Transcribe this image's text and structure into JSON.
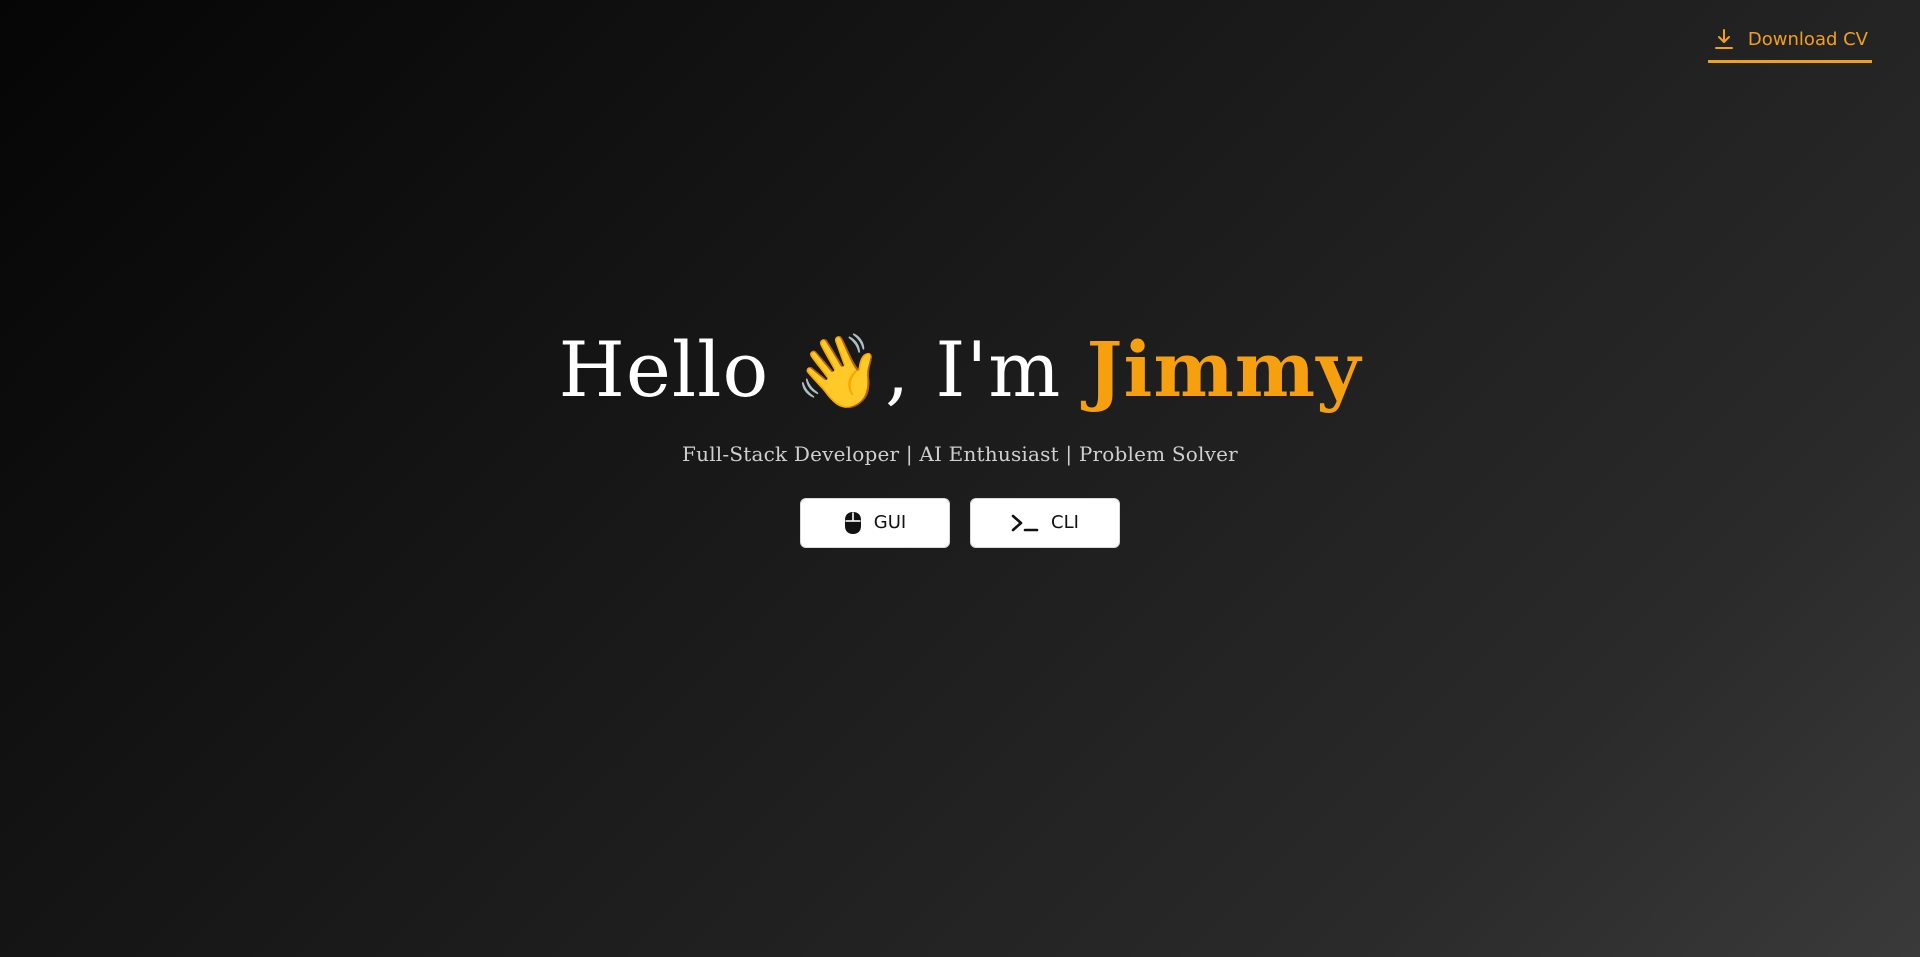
{
  "header": {
    "download_cv_label": "Download CV",
    "download_icon": "download-icon",
    "accent_color": "#f2a01a"
  },
  "hero": {
    "greeting": "Hello",
    "wave_emoji": "👋",
    "intro": ", I'm",
    "name": "Jimmy",
    "tagline": "Full-Stack Developer | AI Enthusiast | Problem Solver"
  },
  "modes": {
    "gui_label": "GUI",
    "gui_icon": "mouse-icon",
    "cli_label": "CLI",
    "cli_icon": "terminal-icon"
  }
}
